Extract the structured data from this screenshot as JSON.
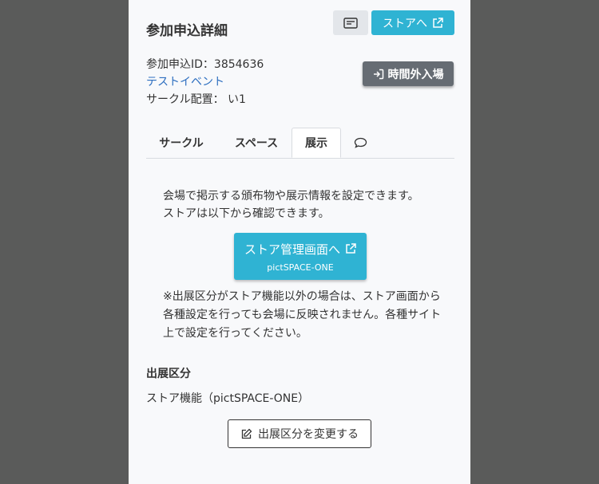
{
  "page": {
    "title": "参加申込詳細",
    "store_button_label": "ストアへ",
    "reentry_button_label": "時間外入場"
  },
  "info": {
    "application_id_label": "参加申込ID：3854636",
    "event_link": "テストイベント",
    "circle_placement": "サークル配置： い1"
  },
  "tabs": [
    {
      "label": "サークル"
    },
    {
      "label": "スペース"
    },
    {
      "label": "展示",
      "active": true
    },
    {
      "label": "",
      "icon": "chat-icon"
    }
  ],
  "content": {
    "description_line1": "会場で掲示する頒布物や展示情報を設定できます。",
    "description_line2": "ストアは以下から確認できます。",
    "manage_button_label": "ストア管理画面へ",
    "manage_button_sub": "pictSPACE-ONE",
    "note": "※出展区分がストア機能以外の場合は、ストア画面から各種設定を行っても会場に反映されません。各種サイト上で設定を行ってください。",
    "exhibit_type_label": "出展区分",
    "exhibit_type_value": "ストア機能（pictSPACE-ONE）",
    "change_button_label": "出展区分を変更する"
  },
  "colors": {
    "accent": "#2fb3d3",
    "dark_button": "#666c73",
    "link": "#2e6fc0",
    "backdrop": "#5a5b5a"
  }
}
